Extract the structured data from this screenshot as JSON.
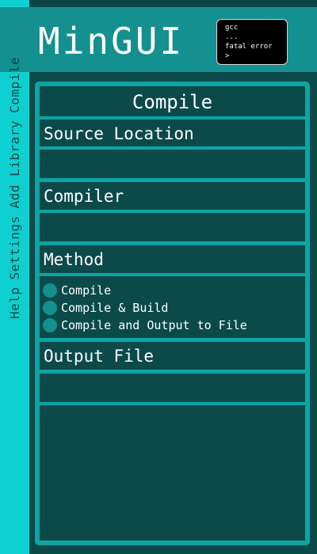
{
  "app": {
    "title": "MinGUI"
  },
  "terminal": {
    "lines": [
      "gcc",
      "...",
      "fatal error",
      ">"
    ]
  },
  "sidebar": {
    "items": [
      "Help",
      "Settings",
      "Add Library",
      "Compile"
    ]
  },
  "panel": {
    "heading": "Compile",
    "source_label": "Source Location",
    "source_value": "",
    "compiler_label": "Compiler",
    "compiler_value": "",
    "method_label": "Method",
    "method_options": [
      "Compile",
      "Compile & Build",
      "Compile and Output to File"
    ],
    "output_label": "Output File",
    "output_value": ""
  },
  "colors": {
    "background": "#0c4a4a",
    "accent": "#0fd0d0",
    "header": "#13908f",
    "panel_border": "#0fa3a3"
  }
}
